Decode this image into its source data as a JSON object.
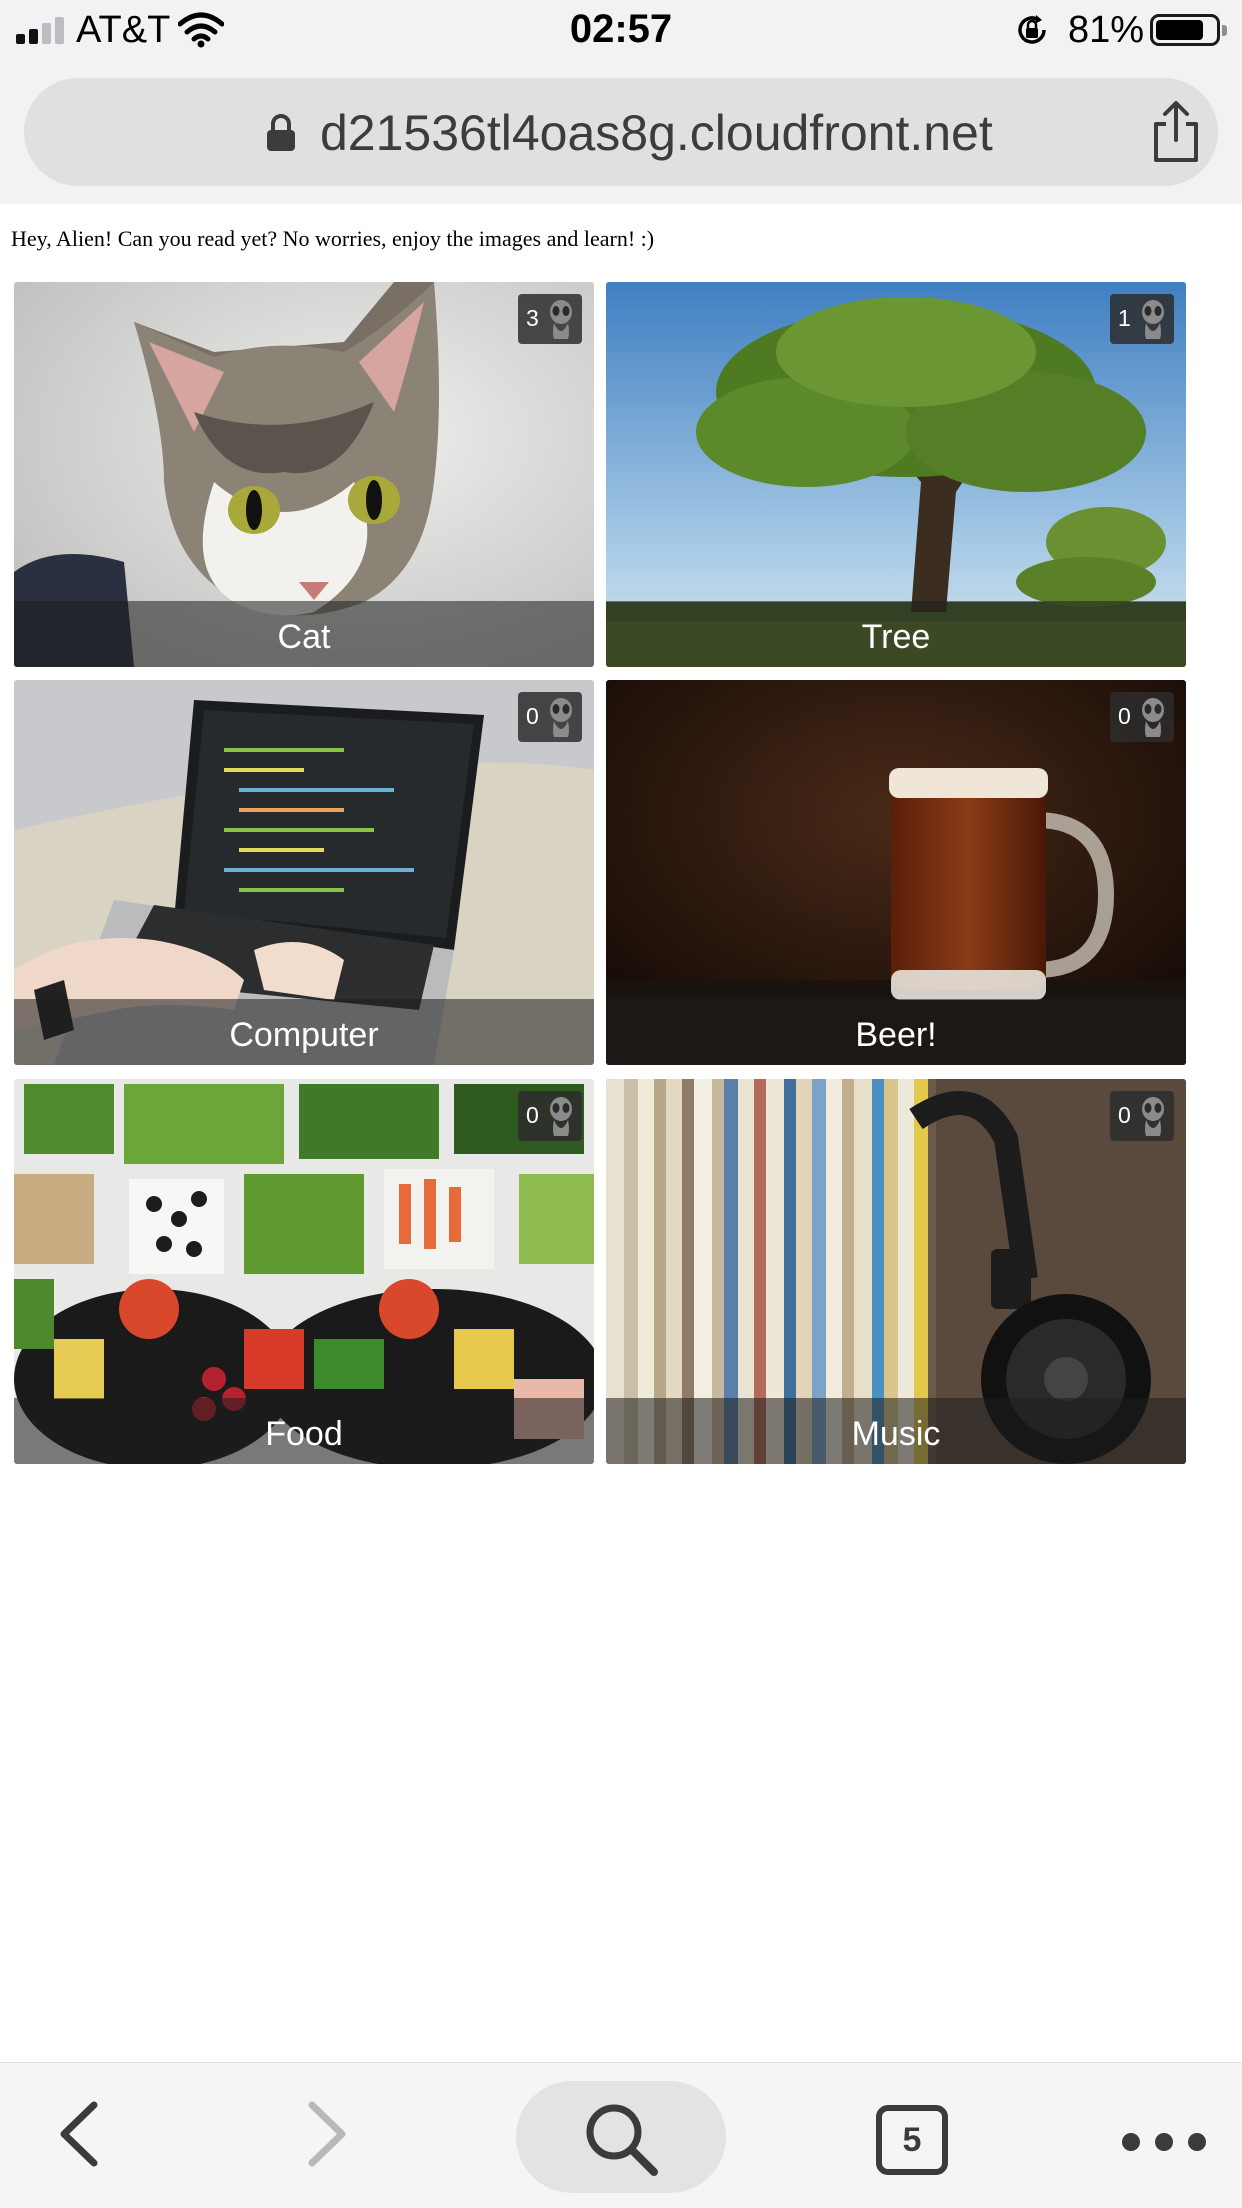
{
  "status_bar": {
    "carrier": "AT&T",
    "time": "02:57",
    "battery_percent": "81%",
    "battery_level": 0.81,
    "signal_bars": 2
  },
  "address_bar": {
    "url": "d21536tl4oas8g.cloudfront.net"
  },
  "page": {
    "intro_text": "Hey, Alien! Can you read yet? No worries, enjoy the images and learn! :)",
    "tiles": [
      {
        "label": "Cat",
        "count": "3",
        "icon": "alien-icon"
      },
      {
        "label": "Tree",
        "count": "1",
        "icon": "alien-icon"
      },
      {
        "label": "Computer",
        "count": "0",
        "icon": "alien-icon"
      },
      {
        "label": "Beer!",
        "count": "0",
        "icon": "alien-icon"
      },
      {
        "label": "Food",
        "count": "0",
        "icon": "alien-icon"
      },
      {
        "label": "Music",
        "count": "0",
        "icon": "alien-icon"
      }
    ]
  },
  "toolbar": {
    "tab_count": "5",
    "icons": [
      "back-icon",
      "forward-icon",
      "search-icon",
      "tabs-icon",
      "more-icon"
    ]
  }
}
